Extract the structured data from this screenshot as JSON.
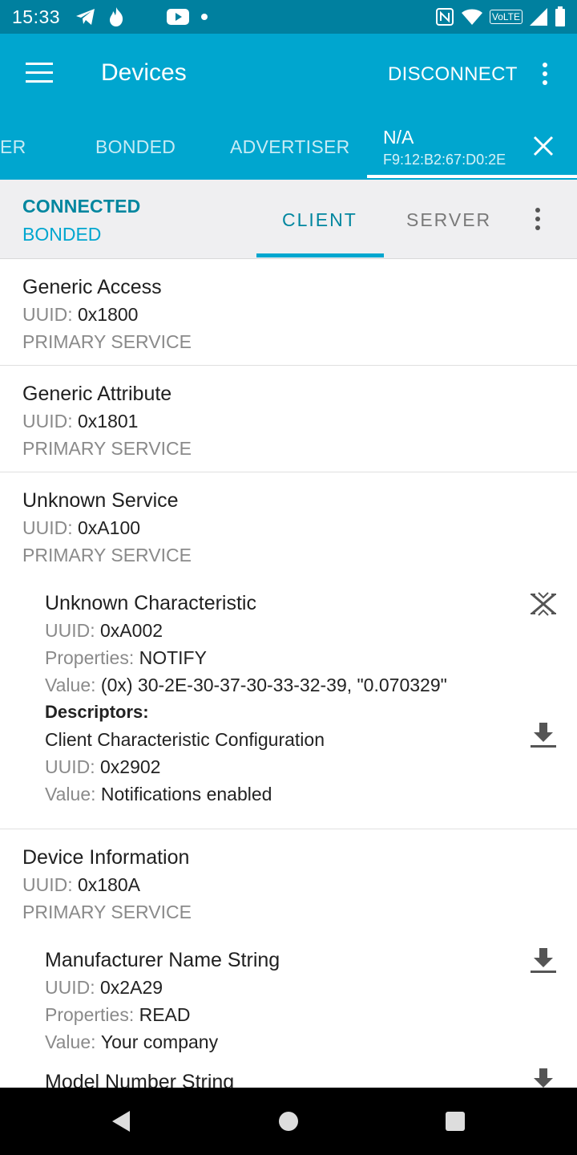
{
  "status_bar": {
    "time": "15:33",
    "left_icons": [
      "telegram-icon",
      "flame-icon",
      "pinwheel-icon",
      "youtube-icon",
      "dot-icon"
    ],
    "right_icons": [
      "nfc-icon",
      "wifi-icon",
      "volte-icon",
      "signal-icon",
      "battery-icon"
    ],
    "volte_label": "VoLTE"
  },
  "app_bar": {
    "title": "Devices",
    "disconnect_label": "DISCONNECT"
  },
  "device_tabs": [
    {
      "label": "ER"
    },
    {
      "label": "BONDED"
    },
    {
      "label": "ADVERTISER"
    }
  ],
  "active_device": {
    "name": "N/A",
    "address": "F9:12:B2:67:D0:2E"
  },
  "connection": {
    "state": "CONNECTED",
    "bond": "BONDED"
  },
  "sub_tabs": {
    "client": "CLIENT",
    "server": "SERVER"
  },
  "labels": {
    "uuid": "UUID:",
    "properties": "Properties:",
    "value": "Value:",
    "descriptors": "Descriptors:"
  },
  "services": [
    {
      "name": "Generic Access",
      "uuid": "0x1800",
      "type": "PRIMARY SERVICE"
    },
    {
      "name": "Generic Attribute",
      "uuid": "0x1801",
      "type": "PRIMARY SERVICE"
    },
    {
      "name": "Unknown Service",
      "uuid": "0xA100",
      "type": "PRIMARY SERVICE",
      "characteristic": {
        "name": "Unknown Characteristic",
        "uuid": "0xA002",
        "properties": "NOTIFY",
        "value": "(0x) 30-2E-30-37-30-33-32-39, \"0.070329\"",
        "descriptor": {
          "name": "Client Characteristic Configuration",
          "uuid": "0x2902",
          "value": "Notifications enabled"
        }
      }
    },
    {
      "name": "Device Information",
      "uuid": "0x180A",
      "type": "PRIMARY SERVICE",
      "characteristics": [
        {
          "name": "Manufacturer Name String",
          "uuid": "0x2A29",
          "properties": "READ",
          "value": "Your company"
        },
        {
          "name": "Model Number String"
        }
      ]
    }
  ],
  "colors": {
    "status_bar": "#00809F",
    "app_bar": "#00A6CF",
    "accent": "#00869F",
    "sub_bar": "#EFEFF1"
  }
}
